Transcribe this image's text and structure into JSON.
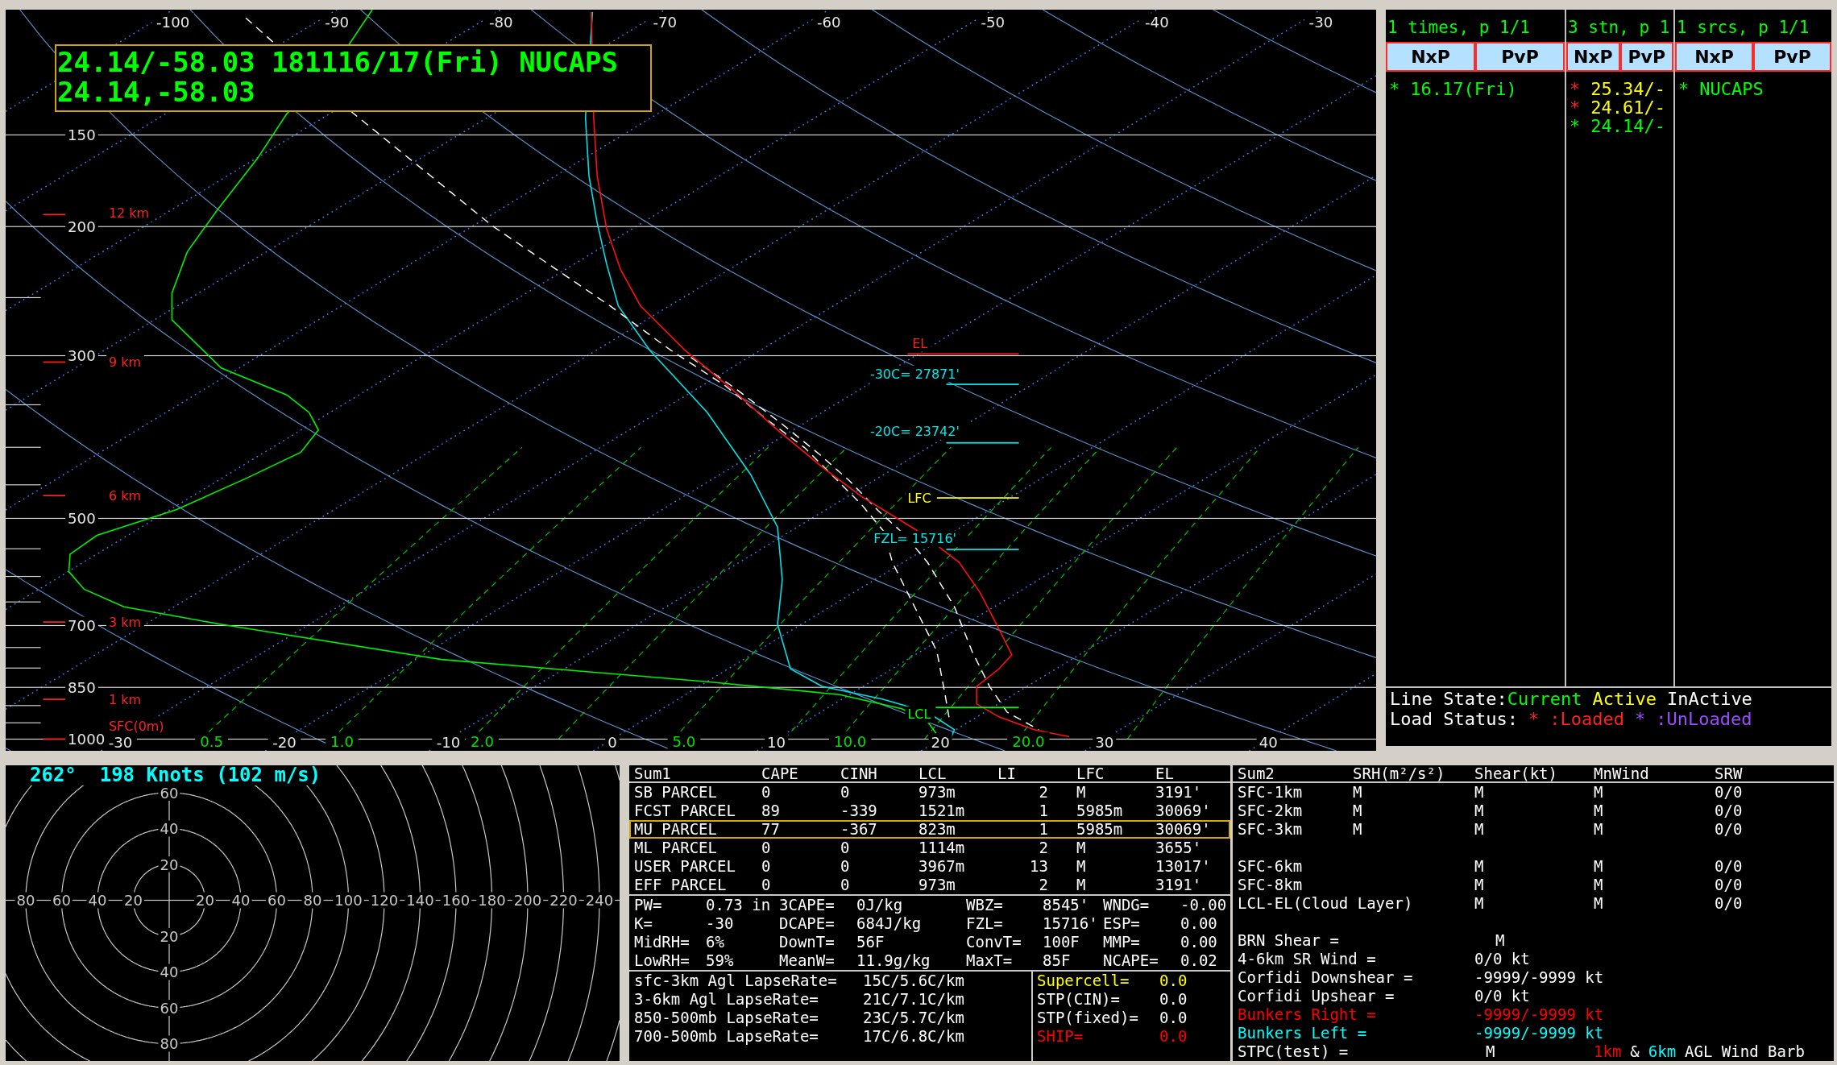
{
  "skewt": {
    "title_lines": [
      "24.14/-58.03 181116/17(Fri) NUCAPS",
      "24.14,-58.03"
    ],
    "top_temperatures": [
      "-100",
      "-90",
      "-80",
      "-70",
      "-60",
      "-50",
      "-40",
      "-30"
    ],
    "pressure_labels": [
      "150",
      "200",
      "300",
      "500",
      "700",
      "850",
      "1000"
    ],
    "height_labels": [
      "12 km",
      "9 km",
      "6 km",
      "3 km",
      "1 km",
      "SFC(0m)"
    ],
    "bottom_temperatures": [
      "-30",
      "-20",
      "-10",
      "0",
      "10",
      "20",
      "30",
      "40"
    ],
    "mixing_ratio_labels": [
      "0.5",
      "1.0",
      "2.0",
      "5.0",
      "10.0",
      "20.0"
    ],
    "levels": [
      {
        "kind": "el",
        "label": "EL"
      },
      {
        "kind": "cold30",
        "label": "-30C= 27871'"
      },
      {
        "kind": "cold20",
        "label": "-20C= 23742'"
      },
      {
        "kind": "lfc",
        "label": "LFC"
      },
      {
        "kind": "fzl",
        "label": "FZL= 15716'"
      },
      {
        "kind": "lcl",
        "label": "LCL"
      }
    ]
  },
  "station_list": {
    "columns": [
      {
        "header": "1 times, p 1/1",
        "buttons": [
          "NxP",
          "PvP"
        ],
        "entries": [
          {
            "marker": "*",
            "label": "16.17(Fri)",
            "kind": "current",
            "loaded": true
          }
        ]
      },
      {
        "header": "3 stn, p 1",
        "buttons": [
          "NxP",
          "PvP"
        ],
        "entries": [
          {
            "marker": "*",
            "label": "25.34/-",
            "kind": "active",
            "loaded": true
          },
          {
            "marker": "*",
            "label": "24.61/-",
            "kind": "active",
            "loaded": true
          },
          {
            "marker": "*",
            "label": "24.14/-",
            "kind": "current",
            "loaded": true
          }
        ]
      },
      {
        "header": "1 srcs, p 1/1",
        "buttons": [
          "NxP",
          "PvP"
        ],
        "entries": [
          {
            "marker": "*",
            "label": "NUCAPS",
            "kind": "current",
            "loaded": true
          }
        ]
      }
    ],
    "legend": {
      "line_state": {
        "label": "Line State:",
        "items": [
          {
            "kind": "current",
            "text": "Current"
          },
          {
            "kind": "active",
            "text": "Active"
          },
          {
            "kind": "inactive",
            "text": "InActive"
          }
        ]
      },
      "load_status": {
        "label": "Load Status:",
        "items": [
          {
            "kind": "loaded",
            "marker": "*",
            "text": ":Loaded"
          },
          {
            "kind": "unloaded",
            "marker": "*",
            "text": ":UnLoaded"
          }
        ]
      }
    }
  },
  "hodograph": {
    "readout": "262°  198 Knots (102 m/s)",
    "left_labels": [
      "80",
      "60",
      "40",
      "20"
    ],
    "right_labels": [
      "20",
      "40",
      "60",
      "80",
      "100",
      "120",
      "140",
      "160",
      "180",
      "200",
      "220",
      "240"
    ],
    "up_labels": [
      "60",
      "40",
      "20"
    ],
    "down_labels": [
      "20",
      "40",
      "60",
      "80"
    ]
  },
  "summary1": {
    "columns": [
      "Sum1",
      "CAPE",
      "CINH",
      "LCL",
      "LI",
      "LFC",
      "EL"
    ],
    "parcels": [
      {
        "cells": [
          "SB PARCEL",
          "0",
          "0",
          "973m",
          "2",
          "M",
          "3191'"
        ],
        "selected": false
      },
      {
        "cells": [
          "FCST PARCEL",
          "89",
          "-339",
          "1521m",
          "1",
          "5985m",
          "30069'"
        ],
        "selected": false
      },
      {
        "cells": [
          "MU PARCEL",
          "77",
          "-367",
          "823m",
          "1",
          "5985m",
          "30069'"
        ],
        "selected": true
      },
      {
        "cells": [
          "ML PARCEL",
          "0",
          "0",
          "1114m",
          "2",
          "M",
          "3655'"
        ],
        "selected": false
      },
      {
        "cells": [
          "USER PARCEL",
          "0",
          "0",
          "3967m",
          "13",
          "M",
          "13017'"
        ],
        "selected": false
      },
      {
        "cells": [
          "EFF PARCEL",
          "0",
          "0",
          "973m",
          "2",
          "M",
          "3191'"
        ],
        "selected": false
      }
    ],
    "indices": [
      {
        "items": [
          {
            "label": "PW=",
            "value": "0.73 in"
          },
          {
            "label": "3CAPE=",
            "value": "0J/kg"
          },
          {
            "label": "WBZ=",
            "value": "8545'"
          },
          {
            "label": "WNDG=",
            "value": "-0.00"
          }
        ]
      },
      {
        "items": [
          {
            "label": "K=",
            "value": "-30"
          },
          {
            "label": "DCAPE=",
            "value": "684J/kg"
          },
          {
            "label": "FZL=",
            "value": "15716'"
          },
          {
            "label": "ESP=",
            "value": "0.00"
          }
        ]
      },
      {
        "items": [
          {
            "label": "MidRH=",
            "value": "6%"
          },
          {
            "label": "DownT=",
            "value": "56F"
          },
          {
            "label": "ConvT=",
            "value": "100F"
          },
          {
            "label": "MMP=",
            "value": "0.00"
          }
        ]
      },
      {
        "items": [
          {
            "label": "LowRH=",
            "value": "59%"
          },
          {
            "label": "MeanW=",
            "value": "11.9g/kg"
          },
          {
            "label": "MaxT=",
            "value": "85F"
          },
          {
            "label": "NCAPE=",
            "value": "0.02"
          }
        ]
      }
    ],
    "lapse_rates": [
      {
        "label": "sfc-3km Agl LapseRate=",
        "value": "15C/5.6C/km"
      },
      {
        "label": "3-6km Agl LapseRate=",
        "value": "21C/7.1C/km"
      },
      {
        "label": "850-500mb LapseRate=",
        "value": "23C/5.7C/km"
      },
      {
        "label": "700-500mb LapseRate=",
        "value": "17C/6.8C/km"
      }
    ],
    "composites": [
      {
        "label": "Supercell=",
        "value": "0.0",
        "color": "#ffff00"
      },
      {
        "label": "STP(CIN)=",
        "value": "0.0",
        "color": "#ffffff"
      },
      {
        "label": "STP(fixed)=",
        "value": "0.0",
        "color": "#ffffff"
      },
      {
        "label": "SHIP=",
        "value": "0.0",
        "color": "#ff0000"
      }
    ]
  },
  "summary2": {
    "columns": [
      "Sum2",
      "SRH(m²/s²)",
      "Shear(kt)",
      "MnWind",
      "SRW"
    ],
    "layer_groups": [
      {
        "rows": [
          {
            "layer": "SFC-1km",
            "srh": "M",
            "shear": "M",
            "mean_wind": "M",
            "srw": "0/0"
          },
          {
            "layer": "SFC-2km",
            "srh": "M",
            "shear": "M",
            "mean_wind": "M",
            "srw": "0/0"
          },
          {
            "layer": "SFC-3km",
            "srh": "M",
            "shear": "M",
            "mean_wind": "M",
            "srw": "0/0"
          }
        ]
      },
      {
        "rows": [
          {
            "layer": "SFC-6km",
            "shear": "M",
            "mean_wind": "M",
            "srw": "0/0"
          },
          {
            "layer": "SFC-8km",
            "shear": "M",
            "mean_wind": "M",
            "srw": "0/0"
          },
          {
            "layer": "LCL-EL(Cloud Layer)",
            "shear": "M",
            "mean_wind": "M",
            "srw": "0/0"
          }
        ]
      }
    ],
    "parameters": [
      {
        "label": "BRN Shear =",
        "value": "M",
        "color": "#ffffff"
      },
      {
        "label": "4-6km SR Wind =",
        "value": "0/0 kt",
        "color": "#ffffff"
      },
      {
        "label": "Corfidi Downshear =",
        "value": "-9999/-9999 kt",
        "color": "#ffffff"
      },
      {
        "label": "Corfidi Upshear =",
        "value": "0/0 kt",
        "color": "#ffffff"
      },
      {
        "label": "Bunkers Right =",
        "value": "-9999/-9999 kt",
        "color": "#ff0000"
      },
      {
        "label": "Bunkers Left =",
        "value": "-9999/-9999 kt",
        "color": "#00ffff"
      },
      {
        "label": "STPC(test) =",
        "value": "M",
        "color": "#ffffff"
      }
    ],
    "barb_legend": [
      {
        "text": "1km",
        "color": "#ff0000"
      },
      {
        "text": "&",
        "color": "#ffffff"
      },
      {
        "text": "6km",
        "color": "#00ffff"
      },
      {
        "text": "AGL Wind Barb",
        "color": "#ffffff"
      }
    ]
  }
}
